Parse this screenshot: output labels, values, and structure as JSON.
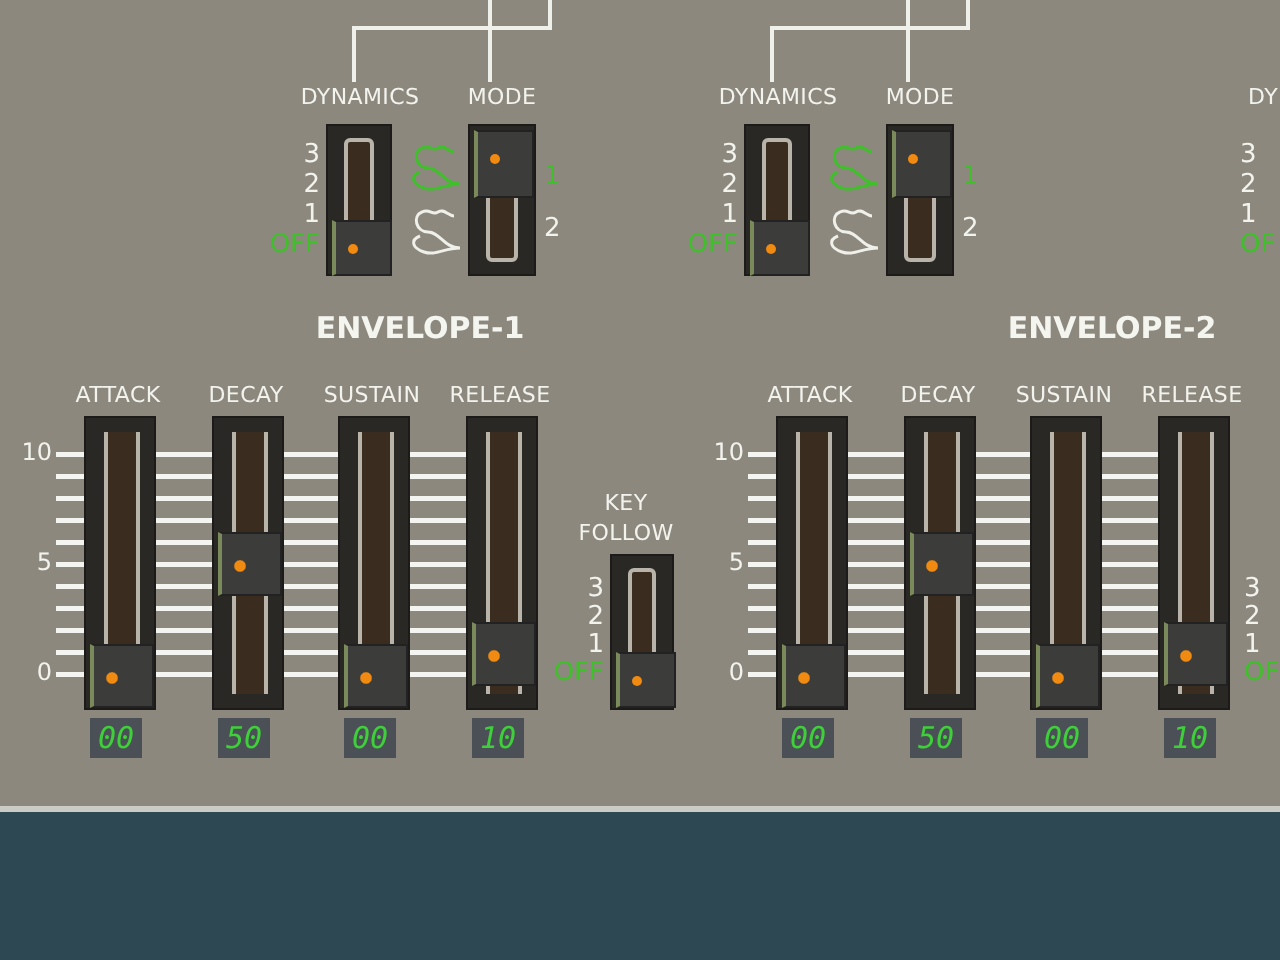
{
  "sections": [
    {
      "dynamics": {
        "label": "DYNAMICS",
        "positions": [
          {
            "label": "3",
            "selected": false
          },
          {
            "label": "2",
            "selected": false
          },
          {
            "label": "1",
            "selected": false
          },
          {
            "label": "OFF",
            "selected": true
          }
        ]
      },
      "mode": {
        "label": "MODE",
        "options": [
          {
            "label": "1",
            "selected": true
          },
          {
            "label": "2",
            "selected": false
          }
        ]
      },
      "title": "ENVELOPE-1",
      "scale": [
        "10",
        "5",
        "0"
      ],
      "sliders": [
        {
          "label": "ATTACK",
          "level": 0,
          "display": "00"
        },
        {
          "label": "DECAY",
          "level": 0.5,
          "display": "50"
        },
        {
          "label": "SUSTAIN",
          "level": 0,
          "display": "00"
        },
        {
          "label": "RELEASE",
          "level": 0.1,
          "display": "10"
        }
      ],
      "key_follow": {
        "label": "KEY FOLLOW",
        "positions": [
          {
            "label": "3",
            "selected": false
          },
          {
            "label": "2",
            "selected": false
          },
          {
            "label": "1",
            "selected": false
          },
          {
            "label": "OFF",
            "selected": true
          }
        ]
      }
    },
    {
      "dynamics": {
        "label": "DYNAMICS",
        "positions": [
          {
            "label": "3",
            "selected": false
          },
          {
            "label": "2",
            "selected": false
          },
          {
            "label": "1",
            "selected": false
          },
          {
            "label": "OFF",
            "selected": true
          }
        ]
      },
      "mode": {
        "label": "MODE",
        "options": [
          {
            "label": "1",
            "selected": true
          },
          {
            "label": "2",
            "selected": false
          }
        ]
      },
      "title": "ENVELOPE-2",
      "scale": [
        "10",
        "5",
        "0"
      ],
      "sliders": [
        {
          "label": "ATTACK",
          "level": 0,
          "display": "00"
        },
        {
          "label": "DECAY",
          "level": 0.5,
          "display": "50"
        },
        {
          "label": "SUSTAIN",
          "level": 0,
          "display": "00"
        },
        {
          "label": "RELEASE",
          "level": 0.1,
          "display": "10"
        }
      ],
      "key_follow": {
        "positions": [
          {
            "label": "3",
            "selected": false
          },
          {
            "label": "2",
            "selected": false
          },
          {
            "label": "1",
            "selected": false
          },
          {
            "label": "OF",
            "selected": true
          }
        ]
      }
    }
  ],
  "edge_dynamics": {
    "label": "DY",
    "positions": [
      {
        "label": "3",
        "selected": false
      },
      {
        "label": "2",
        "selected": false
      },
      {
        "label": "1",
        "selected": false
      },
      {
        "label": "OF",
        "selected": true
      }
    ]
  }
}
